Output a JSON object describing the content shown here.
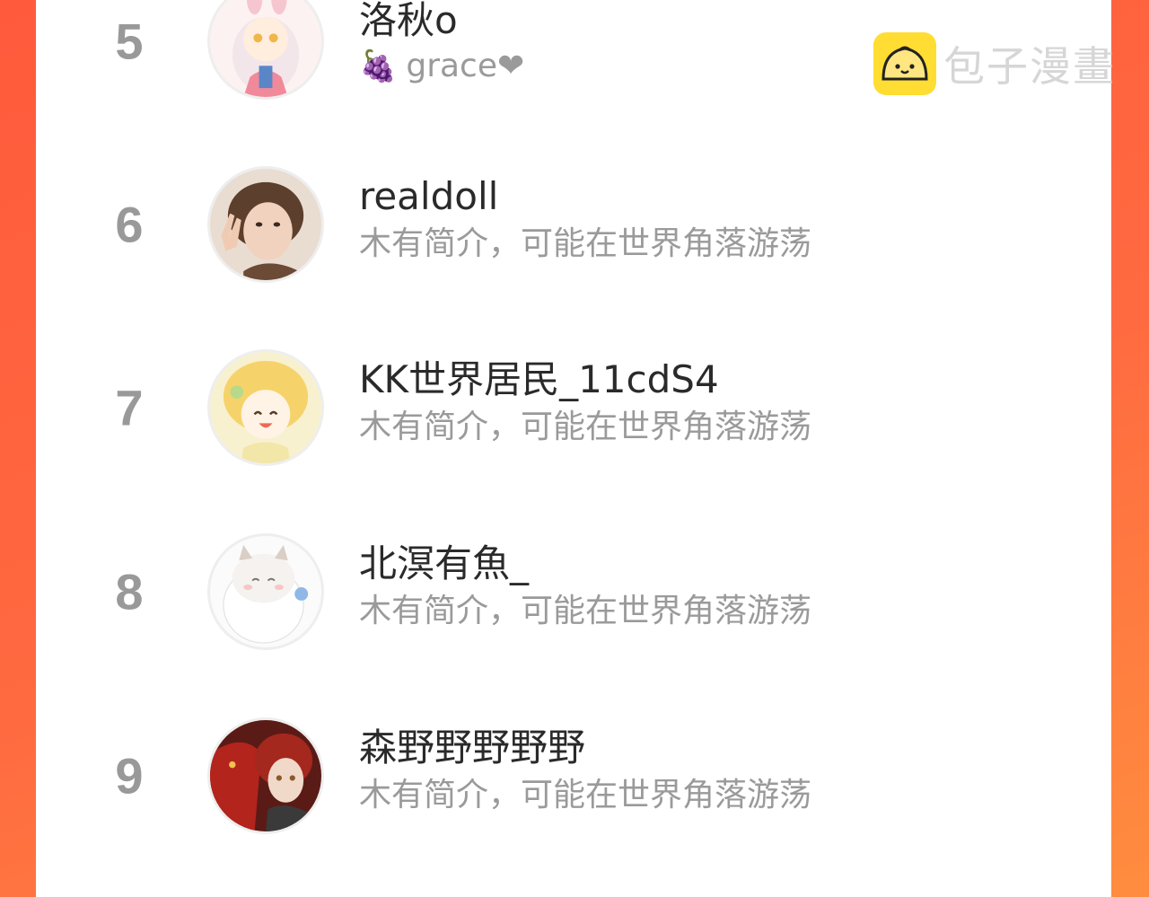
{
  "watermark": {
    "text": "包子漫畫",
    "logo": "bun-mascot-icon"
  },
  "ranking": [
    {
      "rank": "5",
      "username": "洛秋o",
      "bio": "grace❤",
      "bio_prefix": "🍇",
      "avatar": "anime-girl-bunny-avatar"
    },
    {
      "rank": "6",
      "username": "realdoll",
      "bio": "木有简介，可能在世界角落游荡",
      "avatar": "photo-girl-peace-sign-avatar"
    },
    {
      "rank": "7",
      "username": "KK世界居民_11cdS4",
      "bio": "木有简介，可能在世界角落游荡",
      "avatar": "blonde-anime-child-avatar"
    },
    {
      "rank": "8",
      "username": "北溟有魚_",
      "bio": "木有简介，可能在世界角落游荡",
      "avatar": "fluffy-white-cat-avatar"
    },
    {
      "rank": "9",
      "username": "森野野野野野",
      "bio": "木有简介，可能在世界角落游荡",
      "avatar": "red-hair-dragon-avatar"
    }
  ],
  "colors": {
    "background": "#ff6a40",
    "panel": "#ffffff",
    "rank": "#999999",
    "name": "#2a2a2a",
    "bio": "#9a9a9a",
    "watermark_logo": "#ffdd33"
  }
}
